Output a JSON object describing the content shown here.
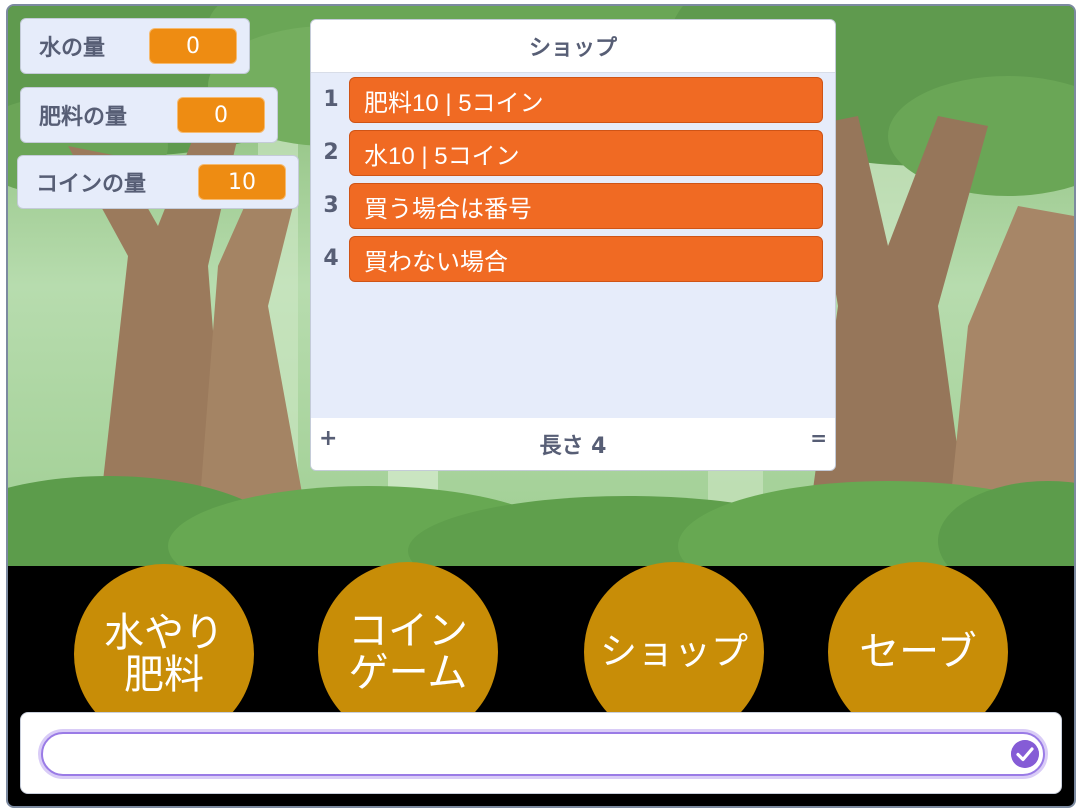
{
  "monitors": [
    {
      "label": "水の量",
      "value": "0"
    },
    {
      "label": "肥料の量",
      "value": "0"
    },
    {
      "label": "コインの量",
      "value": "10"
    }
  ],
  "shop_list": {
    "title": "ショップ",
    "items": [
      {
        "index": "1",
        "text": "肥料10 | 5コイン"
      },
      {
        "index": "2",
        "text": "水10 | 5コイン"
      },
      {
        "index": "3",
        "text": "買う場合は番号"
      },
      {
        "index": "4",
        "text": "買わない場合"
      }
    ],
    "add_label": "+",
    "length_label": "長さ 4",
    "resize_label": "="
  },
  "buttons": [
    {
      "label": "水やり\n肥料"
    },
    {
      "label": "コイン\nゲーム"
    },
    {
      "label": "ショップ"
    },
    {
      "label": "セーブ"
    }
  ],
  "ask": {
    "value": ""
  },
  "colors": {
    "monitor_value": "#ee8c12",
    "list_item": "#f06a23",
    "circle_button": "#c88d07",
    "submit_check": "#855cd6"
  }
}
